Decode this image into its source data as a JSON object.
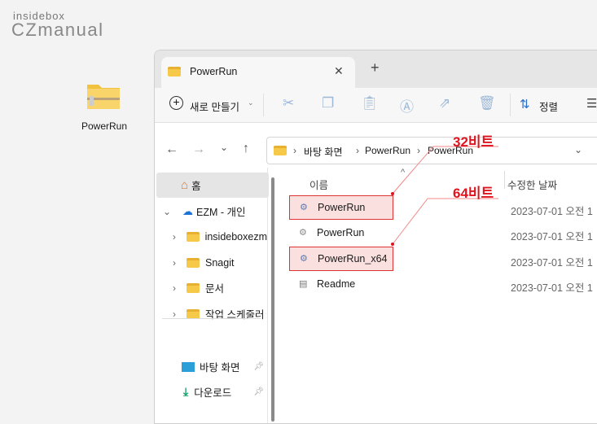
{
  "logo": {
    "top": "insidebox",
    "main": "CZmanual"
  },
  "desktop": {
    "icon_label": "PowerRun",
    "icon": "zip-folder-icon"
  },
  "tab": {
    "title": "PowerRun",
    "close": "✕",
    "new_tab": "+"
  },
  "toolbar": {
    "new_label": "새로 만들기",
    "sort_label": "정렬",
    "view_icon": "☰"
  },
  "address": {
    "crumbs": [
      "바탕 화면",
      "PowerRun",
      "PowerRun"
    ]
  },
  "sidebar": {
    "home": "홈",
    "onedrive": "EZM - 개인",
    "folders": [
      "insideboxezm",
      "Snagit",
      "문서",
      "작업 스케줄러"
    ],
    "pinned": [
      "바탕 화면",
      "다운로드"
    ]
  },
  "columns": {
    "name": "이름",
    "modified": "수정한 날짜"
  },
  "files": [
    {
      "name": "PowerRun",
      "date": "2023-07-01 오전 1",
      "icon": "app-icon"
    },
    {
      "name": "PowerRun",
      "date": "2023-07-01 오전 1",
      "icon": "config-file-icon"
    },
    {
      "name": "PowerRun_x64",
      "date": "2023-07-01 오전 1",
      "icon": "app-icon"
    },
    {
      "name": "Readme",
      "date": "2023-07-01 오전 1",
      "icon": "text-file-icon"
    }
  ],
  "annotations": {
    "a32": "32비트",
    "a64": "64비트",
    "color": "#e0141e"
  }
}
